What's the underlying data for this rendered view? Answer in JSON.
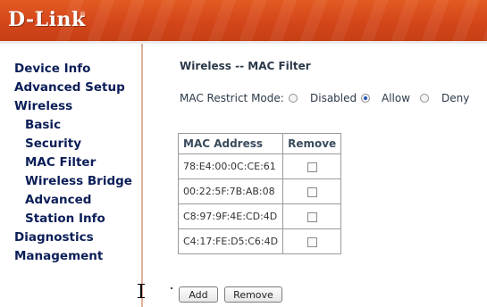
{
  "brand": {
    "logo_text": "D-Link",
    "reg_mark": "®"
  },
  "sidebar": {
    "items": [
      {
        "label": "Device Info",
        "level": 0
      },
      {
        "label": "Advanced Setup",
        "level": 0
      },
      {
        "label": "Wireless",
        "level": 0
      },
      {
        "label": "Basic",
        "level": 1
      },
      {
        "label": "Security",
        "level": 1
      },
      {
        "label": "MAC Filter",
        "level": 1
      },
      {
        "label": "Wireless Bridge",
        "level": 1
      },
      {
        "label": "Advanced",
        "level": 1
      },
      {
        "label": "Station Info",
        "level": 1
      },
      {
        "label": "Diagnostics",
        "level": 0
      },
      {
        "label": "Management",
        "level": 0
      }
    ]
  },
  "main": {
    "title": "Wireless -- MAC Filter",
    "restrict_mode": {
      "label": "MAC Restrict Mode:",
      "selected": "Allow",
      "options": [
        "Disabled",
        "Allow",
        "Deny"
      ]
    },
    "table": {
      "headers": [
        "MAC Address",
        "Remove"
      ],
      "rows": [
        {
          "mac": "78:E4:00:0C:CE:61",
          "remove": false
        },
        {
          "mac": "00:22:5F:7B:AB:08",
          "remove": false
        },
        {
          "mac": "C8:97:9F:4E:CD:4D",
          "remove": false
        },
        {
          "mac": "C4:17:FE:D5:C6:4D",
          "remove": false
        }
      ]
    },
    "buttons": {
      "add": "Add",
      "remove": "Remove"
    }
  },
  "colors": {
    "header": "#d4461a",
    "nav_text": "#0b1e58",
    "radio_selected": "#1c57b5"
  }
}
